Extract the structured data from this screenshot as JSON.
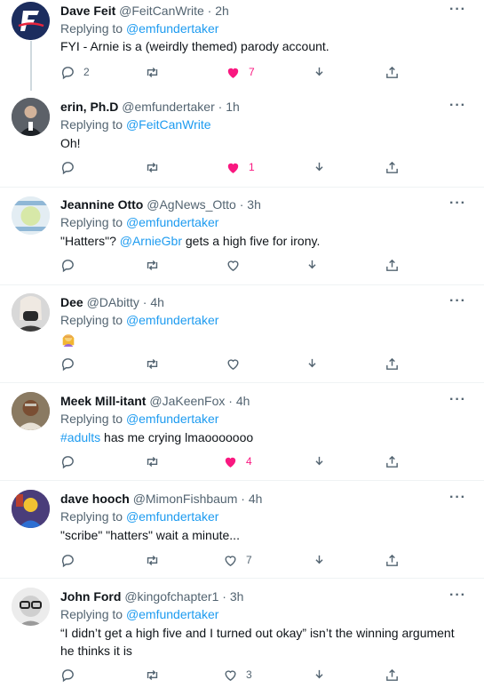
{
  "tweets": [
    {
      "name": "Dave Feit",
      "handle": "@FeitCanWrite",
      "time": "2h",
      "reply_prefix": "Replying to",
      "reply_to": "@emfundertaker",
      "text": "FYI - Arnie is a (weirdly themed) parody account.",
      "replies": "2",
      "retweets": "",
      "likes": "7",
      "liked": true,
      "avatar_icon": "letter-f-logo-icon"
    },
    {
      "name": "erin, Ph.D",
      "handle": "@emfundertaker",
      "time": "1h",
      "reply_prefix": "Replying to",
      "reply_to": "@FeitCanWrite",
      "text": "Oh!",
      "replies": "",
      "retweets": "",
      "likes": "1",
      "liked": true,
      "avatar_icon": "person-photo-icon"
    },
    {
      "name": "Jeannine Otto",
      "handle": "@AgNews_Otto",
      "time": "3h",
      "reply_prefix": "Replying to",
      "reply_to": "@emfundertaker",
      "text_before": "\"Hatters\"? ",
      "mention": "@ArnieGbr",
      "text_after": " gets a high five for irony.",
      "replies": "",
      "retweets": "",
      "likes": "",
      "liked": false,
      "avatar_icon": "enough-feed-logo-icon"
    },
    {
      "name": "Dee",
      "handle": "@DAbitty",
      "time": "4h",
      "reply_prefix": "Replying to",
      "reply_to": "@emfundertaker",
      "text": "",
      "emoji_icon": "woman-facepalming-emoji-icon",
      "replies": "",
      "retweets": "",
      "likes": "",
      "liked": false,
      "avatar_icon": "masked-person-photo-icon"
    },
    {
      "name": "Meek Mill-itant",
      "handle": "@JaKeenFox",
      "time": "4h",
      "reply_prefix": "Replying to",
      "reply_to": "@emfundertaker",
      "hashtag": "#adults",
      "text_after": " has me crying lmaooooooo",
      "replies": "",
      "retweets": "",
      "likes": "4",
      "liked": true,
      "avatar_icon": "person-photo-icon"
    },
    {
      "name": "dave hooch",
      "handle": "@MimonFishbaum",
      "time": "4h",
      "reply_prefix": "Replying to",
      "reply_to": "@emfundertaker",
      "text": "\"scribe\" \"hatters\" wait a minute...",
      "replies": "",
      "retweets": "",
      "likes": "7",
      "liked": false,
      "avatar_icon": "cartoon-photo-icon"
    },
    {
      "name": "John Ford",
      "handle": "@kingofchapter1",
      "time": "3h",
      "reply_prefix": "Replying to",
      "reply_to": "@emfundertaker",
      "text": "“I didn’t get a high five and I turned out okay” isn’t the winning argument he thinks it is",
      "replies": "",
      "retweets": "",
      "likes": "3",
      "liked": false,
      "avatar_icon": "person-glasses-photo-icon"
    }
  ],
  "colors": {
    "accent": "#1d9bf0",
    "like": "#f91880",
    "muted": "#536471",
    "border": "#eff3f4"
  },
  "separator": " · ",
  "more_label": "···"
}
